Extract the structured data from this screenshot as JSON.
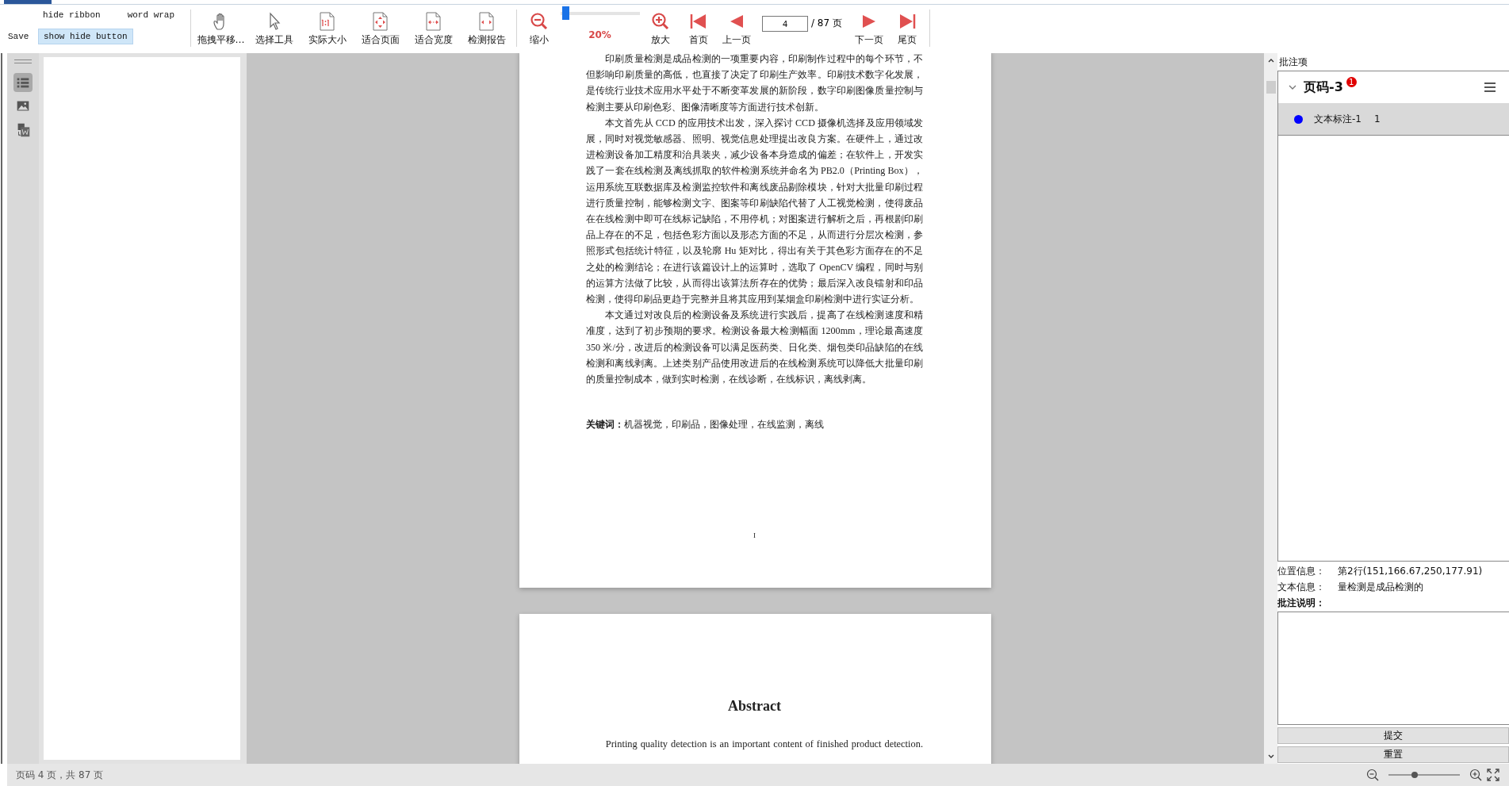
{
  "ribbon": {
    "options": [
      {
        "label": "hide ribbon"
      },
      {
        "label": "word wrap"
      }
    ],
    "save": "Save",
    "show_hide_button": "show hide button",
    "tools": [
      {
        "label": "拖拽平移…",
        "kind": "hand"
      },
      {
        "label": "选择工具",
        "kind": "cursor"
      },
      {
        "label": "实际大小",
        "kind": "actual"
      },
      {
        "label": "适合页面",
        "kind": "fitpage"
      },
      {
        "label": "适合宽度",
        "kind": "fitwidth"
      },
      {
        "label": "检测报告",
        "kind": "report"
      }
    ],
    "zoom": {
      "out": "缩小",
      "level": 0.03,
      "reading": "20%",
      "in": "放大"
    },
    "nav_before": [
      {
        "label": "首页",
        "kind": "first"
      },
      {
        "label": "上一页",
        "kind": "prev"
      }
    ],
    "page_input": "4",
    "page_total": "/ 87 页",
    "nav_after": [
      {
        "label": "下一页",
        "kind": "next"
      },
      {
        "label": "尾页",
        "kind": "last"
      }
    ]
  },
  "sidebar_tabs": [
    {
      "kind": "outline",
      "selected": true
    },
    {
      "kind": "image",
      "selected": false
    },
    {
      "kind": "convert",
      "selected": false
    }
  ],
  "document": {
    "pages": [
      {
        "paragraphs": [
          "印刷质量检测是成品检测的一项重要内容，印刷制作过程中的每个环节，不但影响印刷质量的高低，也直接了决定了印刷生产效率。印刷技术数字化发展，是传统行业技术应用水平处于不断变革发展的新阶段，数字印刷图像质量控制与检测主要从印刷色彩、图像清晰度等方面进行技术创新。",
          "本文首先从 CCD 的应用技术出发，深入探讨 CCD 摄像机选择及应用领域发展，同时对视觉敏感器、照明、视觉信息处理提出改良方案。在硬件上，通过改进检测设备加工精度和治具装夹，减少设备本身造成的偏差；在软件上，开发实践了一套在线检测及离线抓取的软件检测系统并命名为 PB2.0（Printing Box），运用系统互联数据库及检测监控软件和离线废品剔除模块，针对大批量印刷过程进行质量控制，能够检测文字、图案等印刷缺陷代替了人工视觉检测，使得废品在在线检测中即可在线标记缺陷，不用停机；对图案进行解析之后，再根剧印刷品上存在的不足，包括色彩方面以及形态方面的不足，从而进行分层次检测，参照形式包括统计特征，以及轮廓 Hu 矩对比，得出有关于其色彩方面存在的不足之处的检测结论；在进行该篇设计上的运算时，选取了 OpenCV 编程，同时与别的运算方法做了比较，从而得出该算法所存在的优势；最后深入改良镭射和印品检测，使得印刷品更趋于完整并且将其应用到某烟盒印刷检测中进行实证分析。",
          "本文通过对改良后的检测设备及系统进行实践后，提高了在线检测速度和精准度，达到了初步预期的要求。检测设备最大检测幅面 1200mm，理论最高速度 350 米/分，改进后的检测设备可以满足医药类、日化类、烟包类印品缺陷的在线检测和离线剥离。上述类别产品使用改进后的在线检测系统可以降低大批量印刷的质量控制成本，做到实时检测，在线诊断，在线标识，离线剥离。"
        ],
        "keywords": "**关键词：**机器视觉，印刷品，图像处理，在线监测，离线",
        "page_number": "I"
      },
      {
        "heading": "Abstract",
        "paragraphs": [
          "Printing quality detection is an important content of finished product detection."
        ]
      }
    ]
  },
  "annotations": {
    "title": "批注项",
    "groups": [
      {
        "label": "页码-3",
        "badge": "1",
        "expanded": true,
        "items": [
          {
            "label": "文本标注-1",
            "count": "1",
            "color": "#0000ff",
            "selected": true
          }
        ]
      }
    ],
    "details": [
      {
        "label": "位置信息：",
        "value": "第2行(151,166.67,250,177.91)"
      },
      {
        "label": "文本信息：",
        "value": "量检测是成品检测的"
      }
    ],
    "note_label": "批注说明：",
    "buttons": [
      "提交",
      "重置"
    ]
  },
  "status_bar": {
    "text": "页码 4 页，共 87 页",
    "zoom_slider": {
      "level": 0.35
    }
  }
}
